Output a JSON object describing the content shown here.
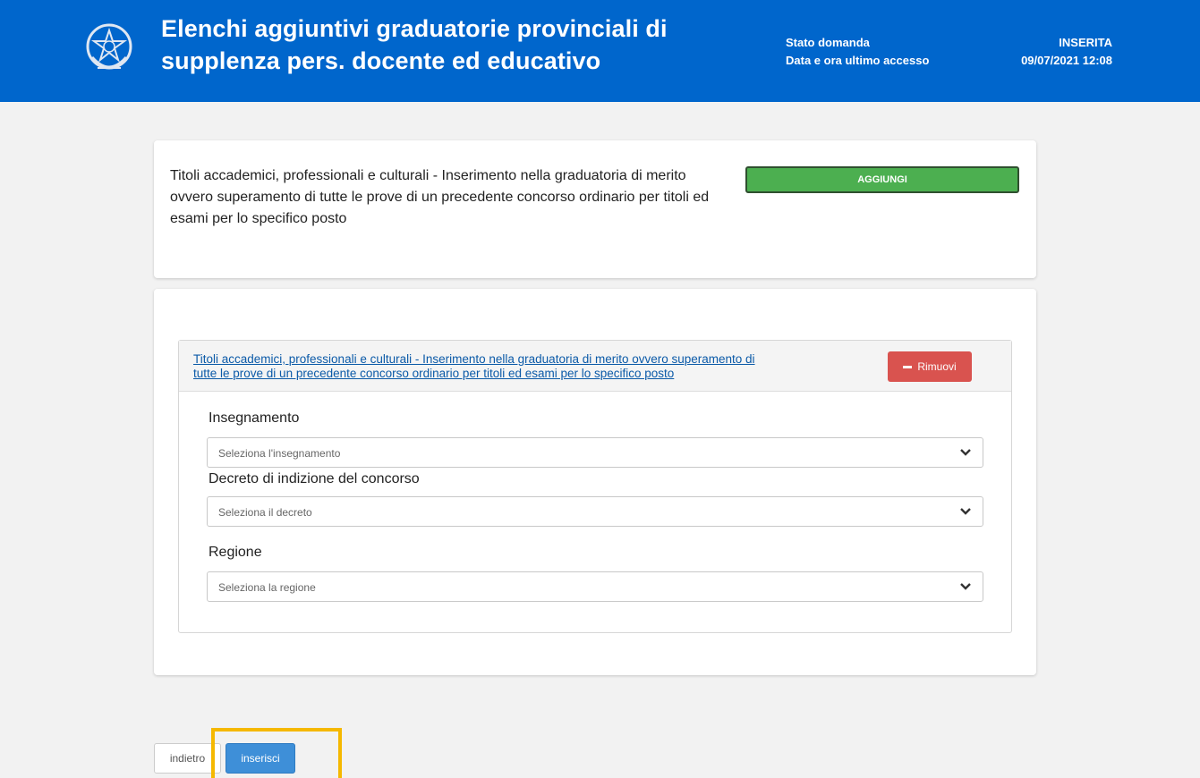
{
  "header": {
    "title_line1": "Elenchi aggiuntivi graduatorie provinciali di",
    "title_line2": "supplenza pers. docente ed educativo",
    "status_label": "Stato domanda",
    "status_value": "INSERITA",
    "last_access_label": "Data e ora ultimo accesso",
    "last_access_value": "09/07/2021 12:08",
    "emblem_icon": "italian-republic-emblem-icon"
  },
  "intro_card": {
    "text": "Titoli accademici, professionali e culturali - Inserimento nella graduatoria di merito ovvero superamento di tutte le prove di un precedente concorso ordinario per titoli ed esami per lo specifico posto",
    "add_button": "AGGIUNGI",
    "add_color": "#4caf50"
  },
  "entry_panel": {
    "title_line1": "Titoli accademici, professionali e culturali - Inserimento nella graduatoria di merito ovvero superamento di",
    "title_line2": "tutte le prove di un precedente concorso ordinario per titoli ed esami per lo specifico posto",
    "remove_button": "Rimuovi",
    "remove_color": "#d9534f",
    "fields": [
      {
        "label": "Insegnamento",
        "placeholder": "Seleziona l'insegnamento"
      },
      {
        "label": "Decreto di indizione del concorso",
        "placeholder": "Seleziona il decreto"
      },
      {
        "label": "Regione",
        "placeholder": "Seleziona la regione"
      }
    ]
  },
  "footer": {
    "back_button": "indietro",
    "submit_button": "inserisci",
    "submit_color": "#3e8fd8",
    "highlight_color": "#f5b800"
  }
}
